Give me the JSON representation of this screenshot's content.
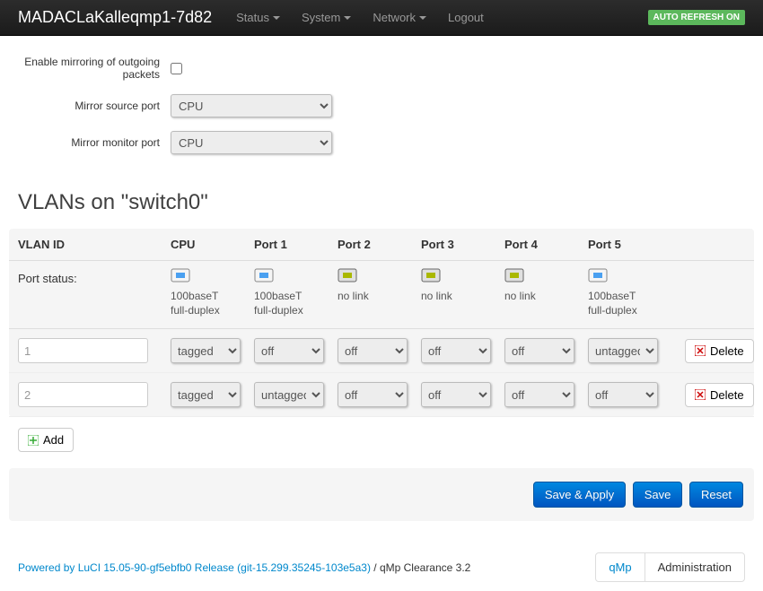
{
  "navbar": {
    "brand": "MADACLaKalleqmp1-7d82",
    "menu": [
      "Status",
      "System",
      "Network",
      "Logout"
    ],
    "auto_refresh": "AUTO REFRESH ON"
  },
  "mirroring": {
    "enable_label": "Enable mirroring of outgoing packets",
    "source_label": "Mirror source port",
    "source_value": "CPU",
    "monitor_label": "Mirror monitor port",
    "monitor_value": "CPU"
  },
  "vlan_section": {
    "title": "VLANs on \"switch0\"",
    "headers": [
      "VLAN ID",
      "CPU",
      "Port 1",
      "Port 2",
      "Port 3",
      "Port 4",
      "Port 5"
    ],
    "port_status_label": "Port status:",
    "port_status": [
      {
        "link": true,
        "text1": "100baseT",
        "text2": "full-duplex"
      },
      {
        "link": true,
        "text1": "100baseT",
        "text2": "full-duplex"
      },
      {
        "link": false,
        "text1": "no link",
        "text2": ""
      },
      {
        "link": false,
        "text1": "no link",
        "text2": ""
      },
      {
        "link": false,
        "text1": "no link",
        "text2": ""
      },
      {
        "link": true,
        "text1": "100baseT",
        "text2": "full-duplex"
      }
    ],
    "rows": [
      {
        "id": "1",
        "ports": [
          "tagged",
          "off",
          "off",
          "off",
          "off",
          "untagged"
        ]
      },
      {
        "id": "2",
        "ports": [
          "tagged",
          "untagged",
          "off",
          "off",
          "off",
          "off"
        ]
      }
    ],
    "delete_label": "Delete",
    "add_label": "Add"
  },
  "actions": {
    "save_apply": "Save & Apply",
    "save": "Save",
    "reset": "Reset"
  },
  "footer": {
    "link_text": "Powered by LuCI 15.05-90-gf5ebfb0 Release (git-15.299.35245-103e5a3)",
    "suffix": " / qMp Clearance 3.2",
    "tabs": [
      "qMp",
      "Administration"
    ]
  }
}
